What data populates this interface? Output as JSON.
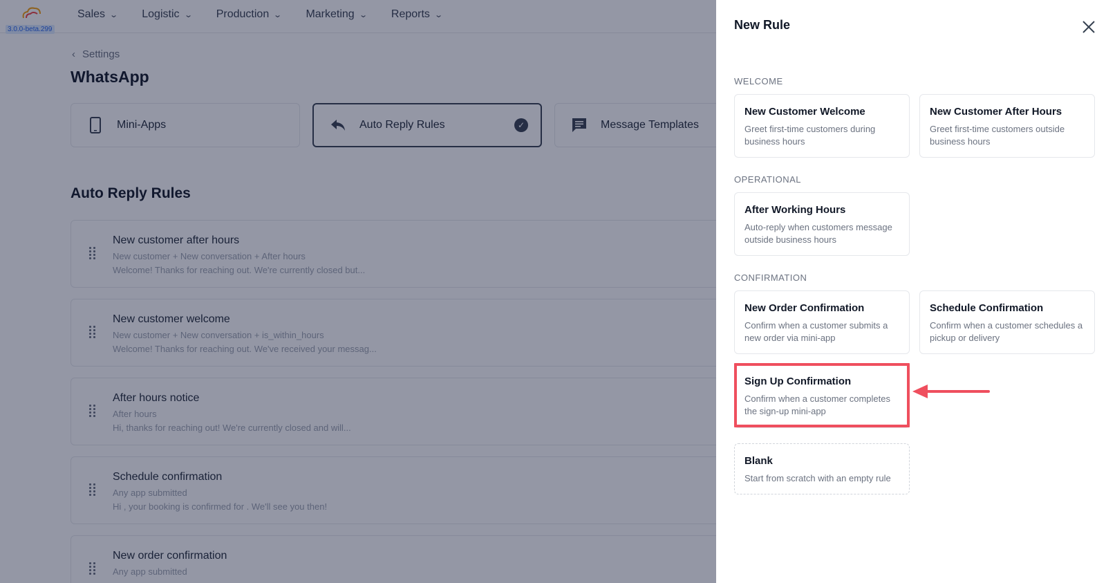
{
  "app": {
    "version": "3.0.0-beta.299",
    "nav": [
      {
        "label": "Sales"
      },
      {
        "label": "Logistic"
      },
      {
        "label": "Production"
      },
      {
        "label": "Marketing"
      },
      {
        "label": "Reports"
      }
    ],
    "breadcrumb": "Settings",
    "page_title": "WhatsApp",
    "tabs": [
      {
        "label": "Mini-Apps",
        "icon": "phone-icon",
        "active": false
      },
      {
        "label": "Auto Reply Rules",
        "icon": "reply-icon",
        "active": true
      },
      {
        "label": "Message Templates",
        "icon": "message-icon",
        "active": false
      }
    ],
    "section_title": "Auto Reply Rules",
    "rules": [
      {
        "title": "New customer after hours",
        "conditions": "New customer + New conversation + After hours",
        "message": "Welcome! Thanks for reaching out. We're currently closed but..."
      },
      {
        "title": "New customer welcome",
        "conditions": "New customer + New conversation + is_within_hours",
        "message": "Welcome! Thanks for reaching out. We've received your messag..."
      },
      {
        "title": "After hours notice",
        "conditions": "After hours",
        "message": "Hi, thanks for reaching out! We're currently closed and will..."
      },
      {
        "title": "Schedule confirmation",
        "conditions": "Any app submitted",
        "message": "Hi , your booking is confirmed for . We'll see you then!"
      },
      {
        "title": "New order confirmation",
        "conditions": "Any app submitted",
        "message": ""
      }
    ]
  },
  "drawer": {
    "title": "New Rule",
    "groups": {
      "welcome": "WELCOME",
      "operational": "OPERATIONAL",
      "confirmation": "CONFIRMATION"
    },
    "templates": {
      "new_customer_welcome": {
        "title": "New Customer Welcome",
        "desc": "Greet first-time customers during business hours"
      },
      "new_customer_after_hours": {
        "title": "New Customer After Hours",
        "desc": "Greet first-time customers outside business hours"
      },
      "after_working_hours": {
        "title": "After Working Hours",
        "desc": "Auto-reply when customers message outside business hours"
      },
      "new_order_confirmation": {
        "title": "New Order Confirmation",
        "desc": "Confirm when a customer submits a new order via mini-app"
      },
      "schedule_confirmation": {
        "title": "Schedule Confirmation",
        "desc": "Confirm when a customer schedules a pickup or delivery"
      },
      "sign_up_confirmation": {
        "title": "Sign Up Confirmation",
        "desc": "Confirm when a customer completes the sign-up mini-app"
      },
      "blank": {
        "title": "Blank",
        "desc": "Start from scratch with an empty rule"
      }
    }
  },
  "colors": {
    "highlight": "#ef4f5e",
    "overlay": "#111837"
  }
}
